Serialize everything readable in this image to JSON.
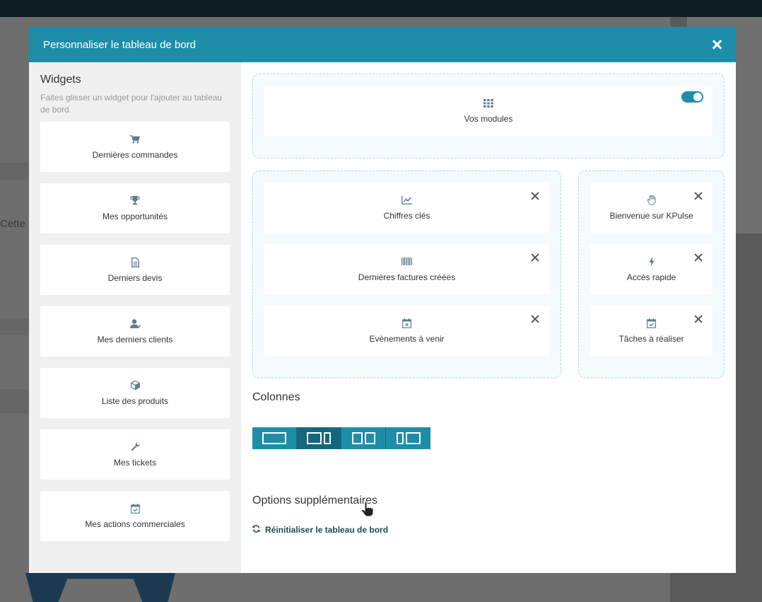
{
  "background": {
    "partial_text": "Cette li"
  },
  "modal": {
    "title": "Personnaliser le tableau de bord"
  },
  "sidebar": {
    "title": "Widgets",
    "help": "Faites glisser un widget pour l'ajouter au tableau de bord.",
    "widgets": [
      {
        "label": "Dernières commandes",
        "icon": "cart-icon"
      },
      {
        "label": "Mes opportunités",
        "icon": "trophy-icon"
      },
      {
        "label": "Derniers devis",
        "icon": "document-icon"
      },
      {
        "label": "Mes derniers clients",
        "icon": "user-icon"
      },
      {
        "label": "Liste des produits",
        "icon": "cube-icon"
      },
      {
        "label": "Mes tickets",
        "icon": "wrench-icon"
      },
      {
        "label": "Mes actions commerciales",
        "icon": "calendar-check-icon"
      }
    ]
  },
  "dashboard": {
    "top": {
      "label": "Vos modules",
      "icon": "grid-icon",
      "toggle_on": true
    },
    "left": [
      {
        "label": "Chiffres clés",
        "icon": "line-chart-icon"
      },
      {
        "label": "Dernières factures créées",
        "icon": "barcode-icon"
      },
      {
        "label": "Evènements à venir",
        "icon": "calendar-x-icon"
      }
    ],
    "right": [
      {
        "label": "Bienvenue sur KPulse",
        "icon": "hand-icon"
      },
      {
        "label": "Accès rapide",
        "icon": "bolt-icon"
      },
      {
        "label": "Tâches à réaliser",
        "icon": "calendar-check-icon"
      }
    ]
  },
  "columns": {
    "title": "Colonnes",
    "selected_index": 1
  },
  "options": {
    "title": "Options supplémentaires",
    "reset_label": "Réinitialiser le tableau de bord"
  },
  "colors": {
    "accent": "#1e8ea8",
    "accent_dark": "#14677c",
    "reset_text": "#1b4b5a"
  }
}
